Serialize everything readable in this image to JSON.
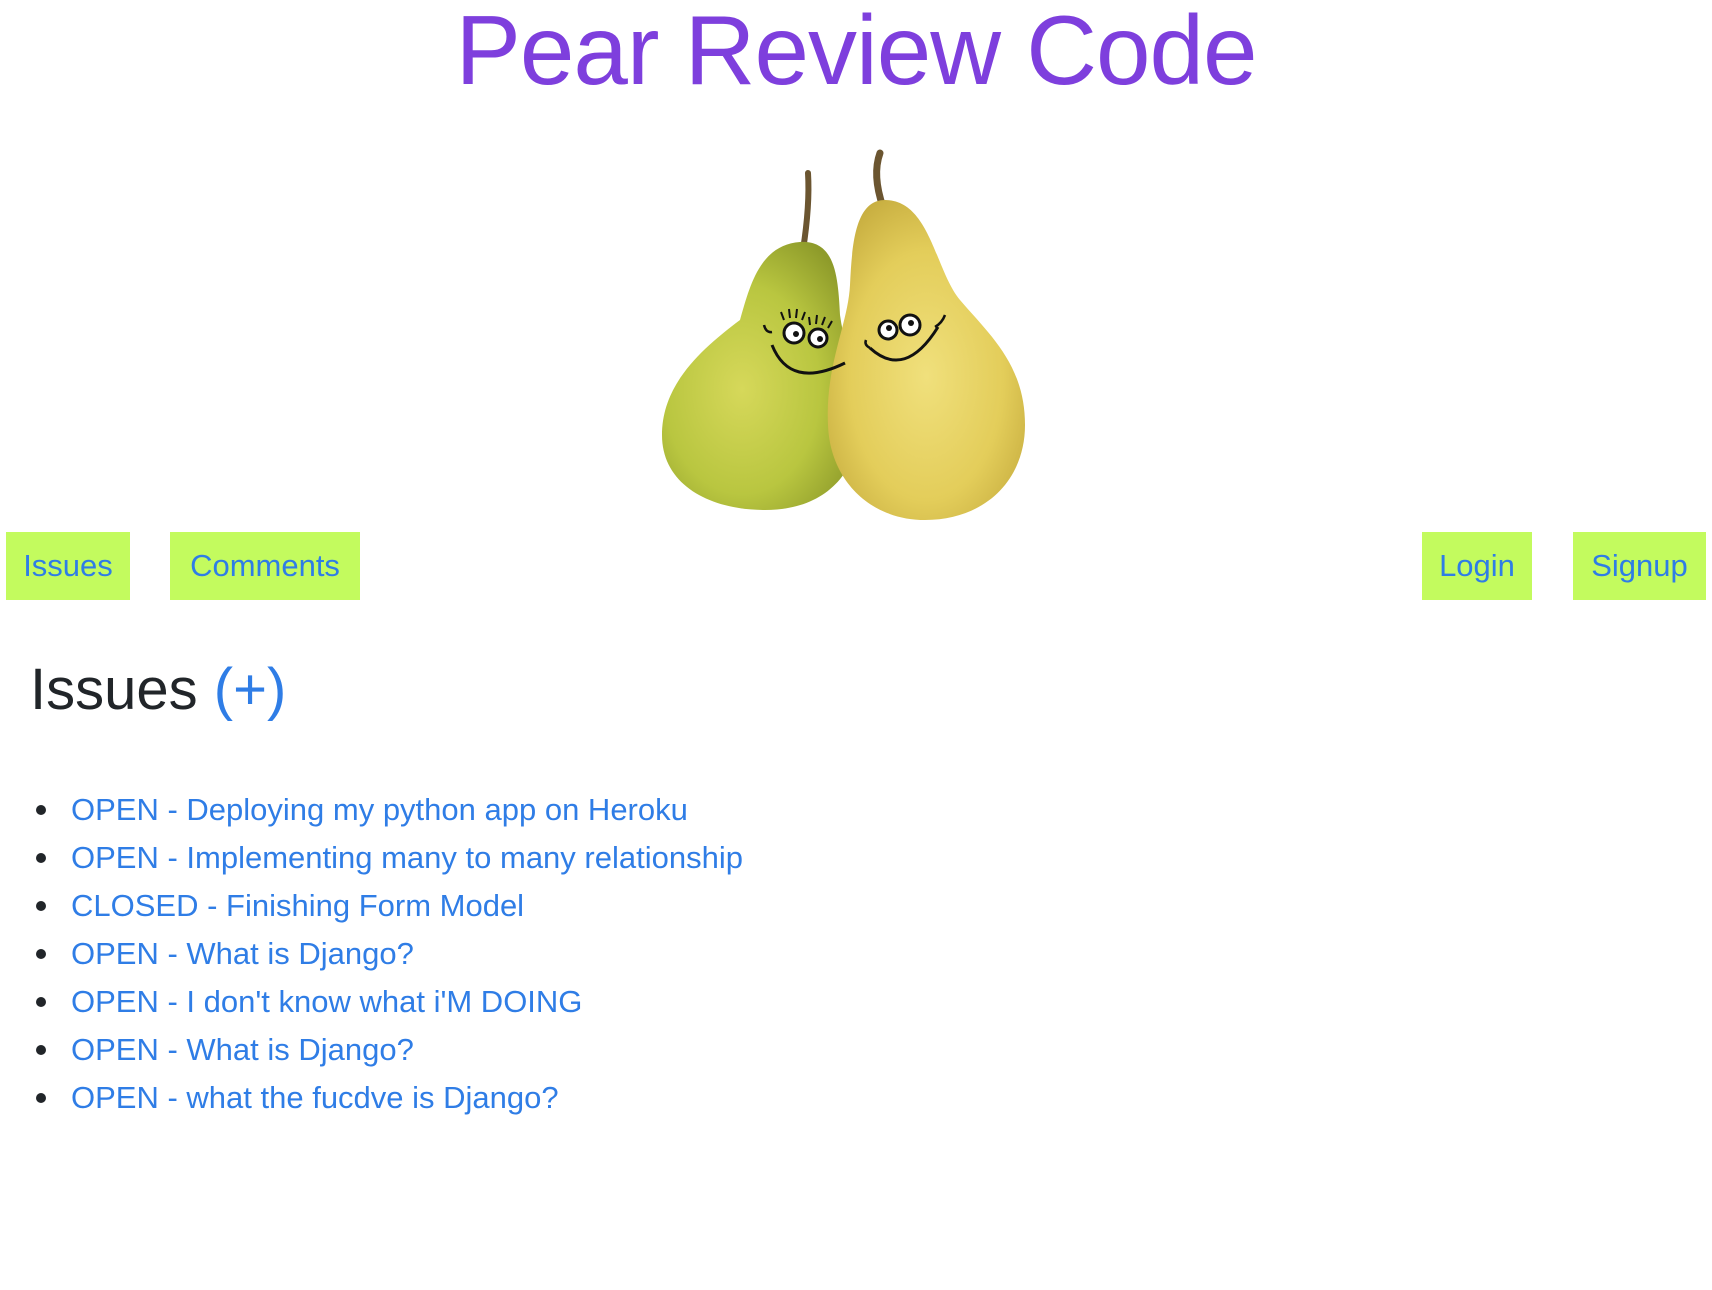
{
  "header": {
    "title": "Pear Review Code",
    "title_color": "#7e3fdd"
  },
  "logo": {
    "icon": "pear-couple-logo"
  },
  "nav": {
    "left": [
      {
        "label": "Issues"
      },
      {
        "label": "Comments"
      }
    ],
    "right": [
      {
        "label": "Login"
      },
      {
        "label": "Signup"
      }
    ],
    "button_bg": "#c3fb5e",
    "link_color": "#2f7de6"
  },
  "main": {
    "heading": "Issues",
    "add_label": "(+)",
    "issues": [
      {
        "label": "OPEN - Deploying my python app on Heroku"
      },
      {
        "label": "OPEN - Implementing many to many relationship"
      },
      {
        "label": "CLOSED - Finishing Form Model"
      },
      {
        "label": "OPEN - What is Django?"
      },
      {
        "label": "OPEN - I don't know what i'M DOING"
      },
      {
        "label": "OPEN - What is Django?"
      },
      {
        "label": "OPEN - what the fucdve is Django?"
      }
    ]
  }
}
